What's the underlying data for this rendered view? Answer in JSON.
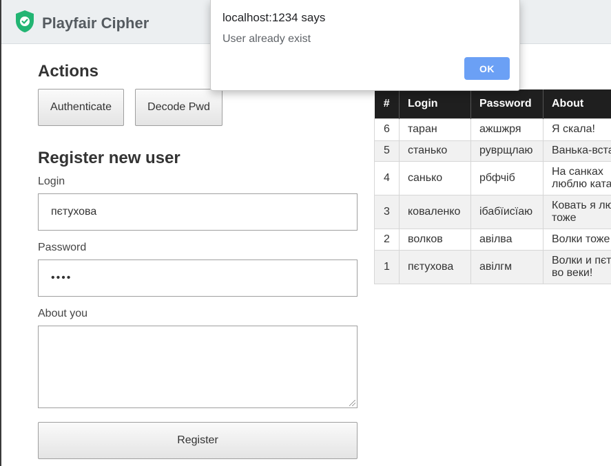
{
  "app": {
    "title": "Playfair Cipher",
    "logo_icon": "shield-check-icon",
    "brand_color": "#22b573"
  },
  "actions": {
    "heading": "Actions",
    "authenticate_label": "Authenticate",
    "decode_label": "Decode Pwd"
  },
  "register": {
    "heading": "Register new user",
    "login_label": "Login",
    "login_value": "пєтухова",
    "password_label": "Password",
    "password_value": "••••",
    "about_label": "About you",
    "about_value": "",
    "submit_label": "Register"
  },
  "users_table": {
    "headers": [
      "#",
      "Login",
      "Password",
      "About"
    ],
    "rows": [
      {
        "id": "6",
        "login": "таран",
        "password": "ажшжря",
        "about": "Я скала!"
      },
      {
        "id": "5",
        "login": "станько",
        "password": "руврщлаю",
        "about": "Ванька-встанька"
      },
      {
        "id": "4",
        "login": "санько",
        "password": "рбфчіб",
        "about": "На санках люблю кататься"
      },
      {
        "id": "3",
        "login": "коваленко",
        "password": "ібабїисїаю",
        "about": "Ковать я люблю тоже"
      },
      {
        "id": "2",
        "login": "волков",
        "password": "авілва",
        "about": "Волки тоже"
      },
      {
        "id": "1",
        "login": "пєтухова",
        "password": "авілгм",
        "about": "Волки и пєтухи во веки!"
      }
    ]
  },
  "alert": {
    "title": "localhost:1234 says",
    "message": "User already exist",
    "ok_label": "OK",
    "ok_color": "#6ba0f5"
  }
}
